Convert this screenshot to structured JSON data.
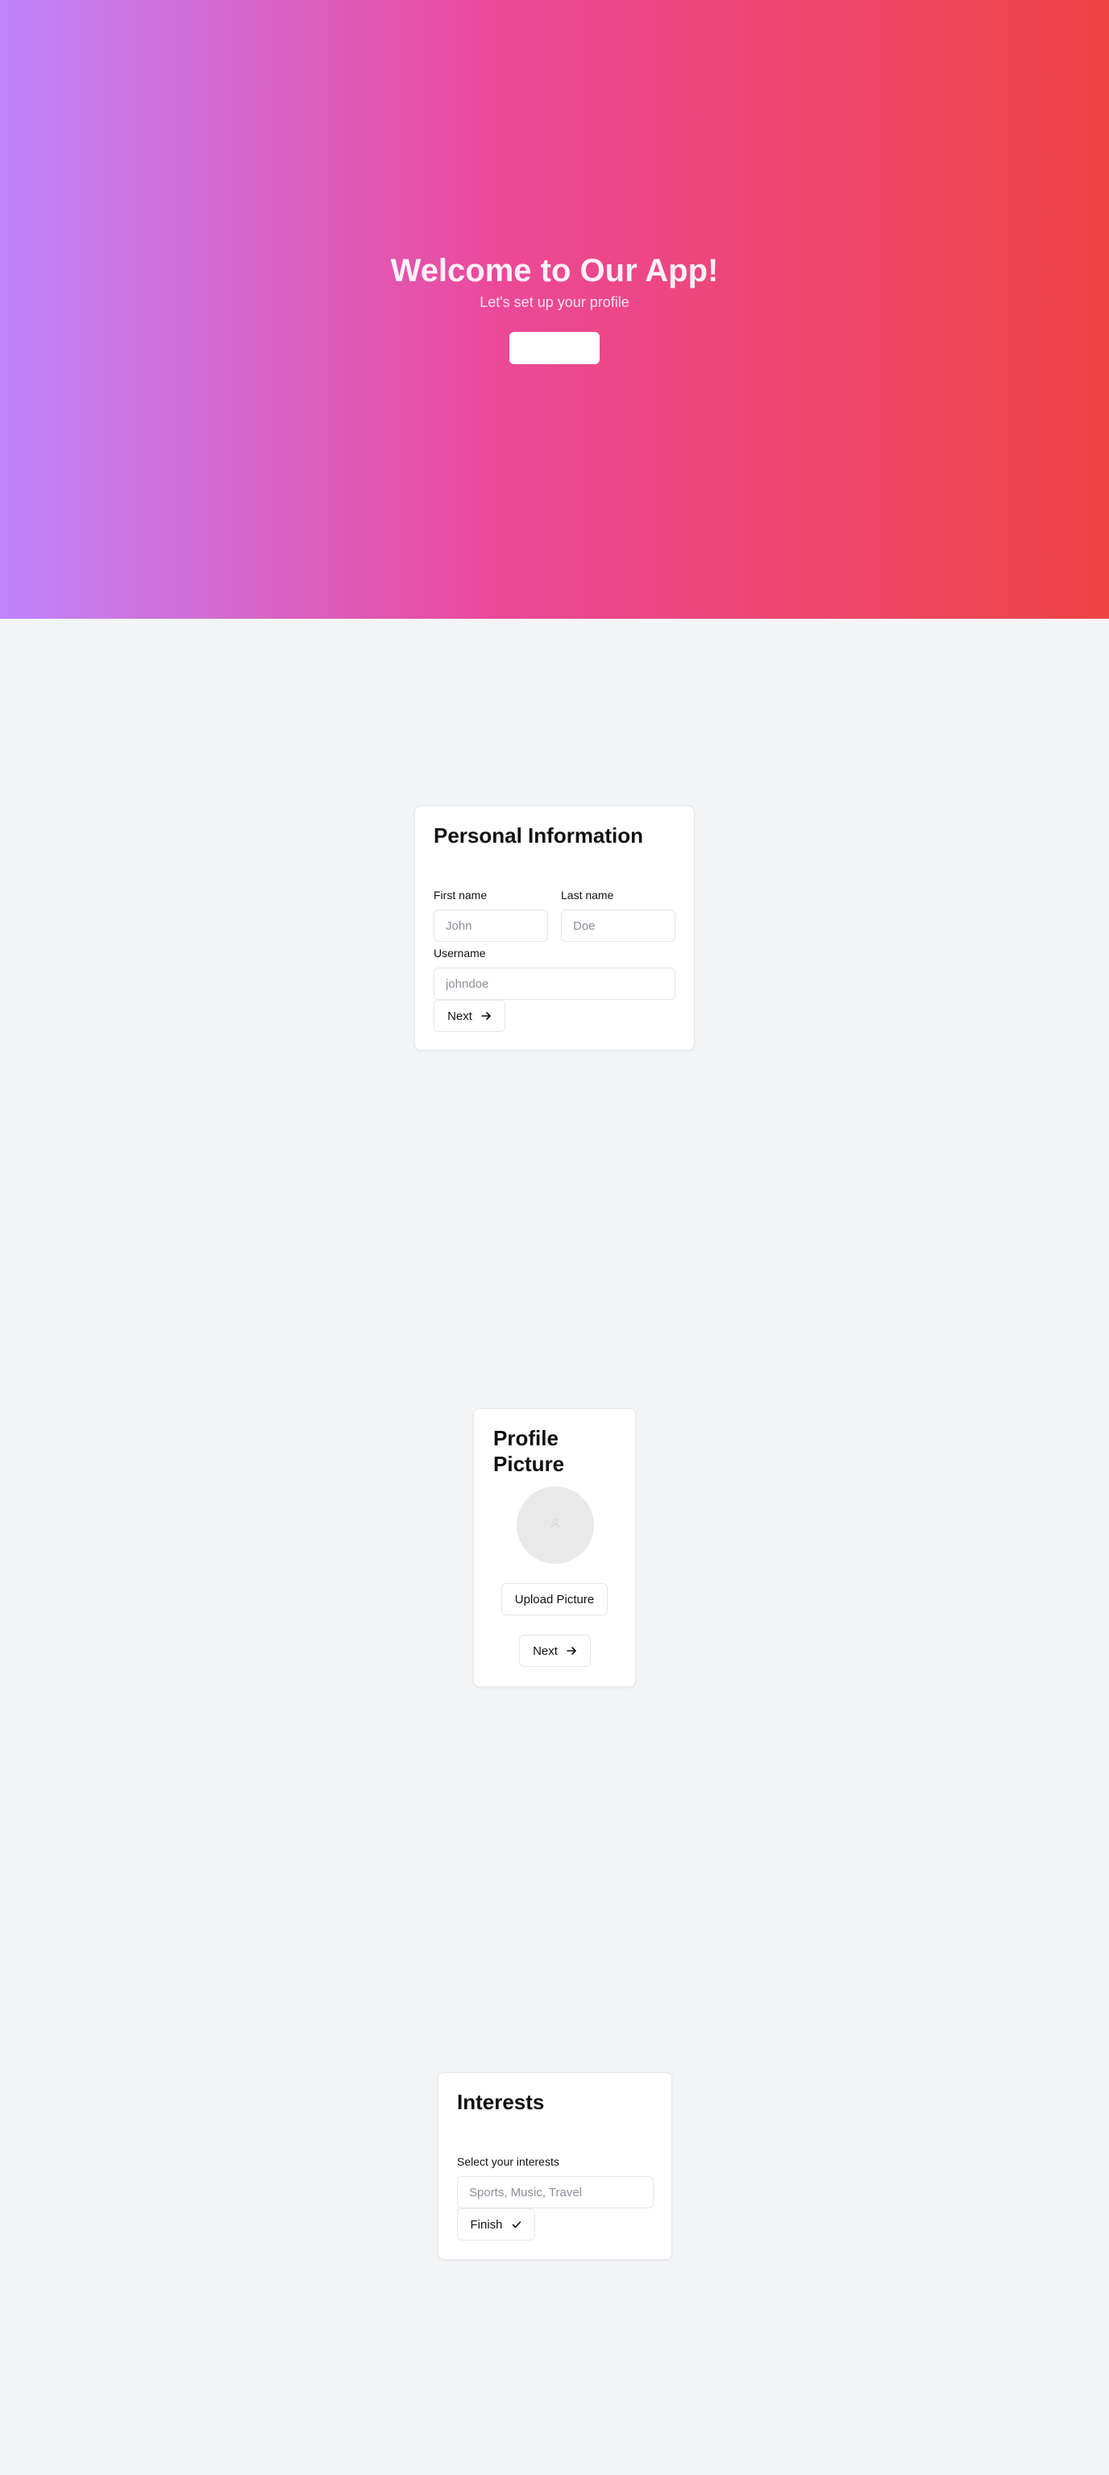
{
  "hero": {
    "title": "Welcome to Our App!",
    "subtitle": "Let's set up your profile",
    "gradient": [
      "#c084fc",
      "#ec4899",
      "#ef4444"
    ]
  },
  "personal_info": {
    "title": "Personal Information",
    "first_name_label": "First name",
    "first_name_placeholder": "John",
    "last_name_label": "Last name",
    "last_name_placeholder": "Doe",
    "username_label": "Username",
    "username_placeholder": "johndoe",
    "next_label": "Next",
    "next_icon": "arrow-right-icon"
  },
  "profile_picture": {
    "title": "Profile Picture",
    "avatar_icon": "user-icon",
    "upload_label": "Upload Picture",
    "next_label": "Next",
    "next_icon": "arrow-right-icon"
  },
  "interests": {
    "title": "Interests",
    "select_label": "Select your interests",
    "input_placeholder": "Sports, Music, Travel",
    "finish_label": "Finish",
    "finish_icon": "check-icon"
  },
  "colors": {
    "page_bg": "#f3f4f6",
    "card_bg": "#ffffff",
    "border": "#e5e7eb"
  }
}
